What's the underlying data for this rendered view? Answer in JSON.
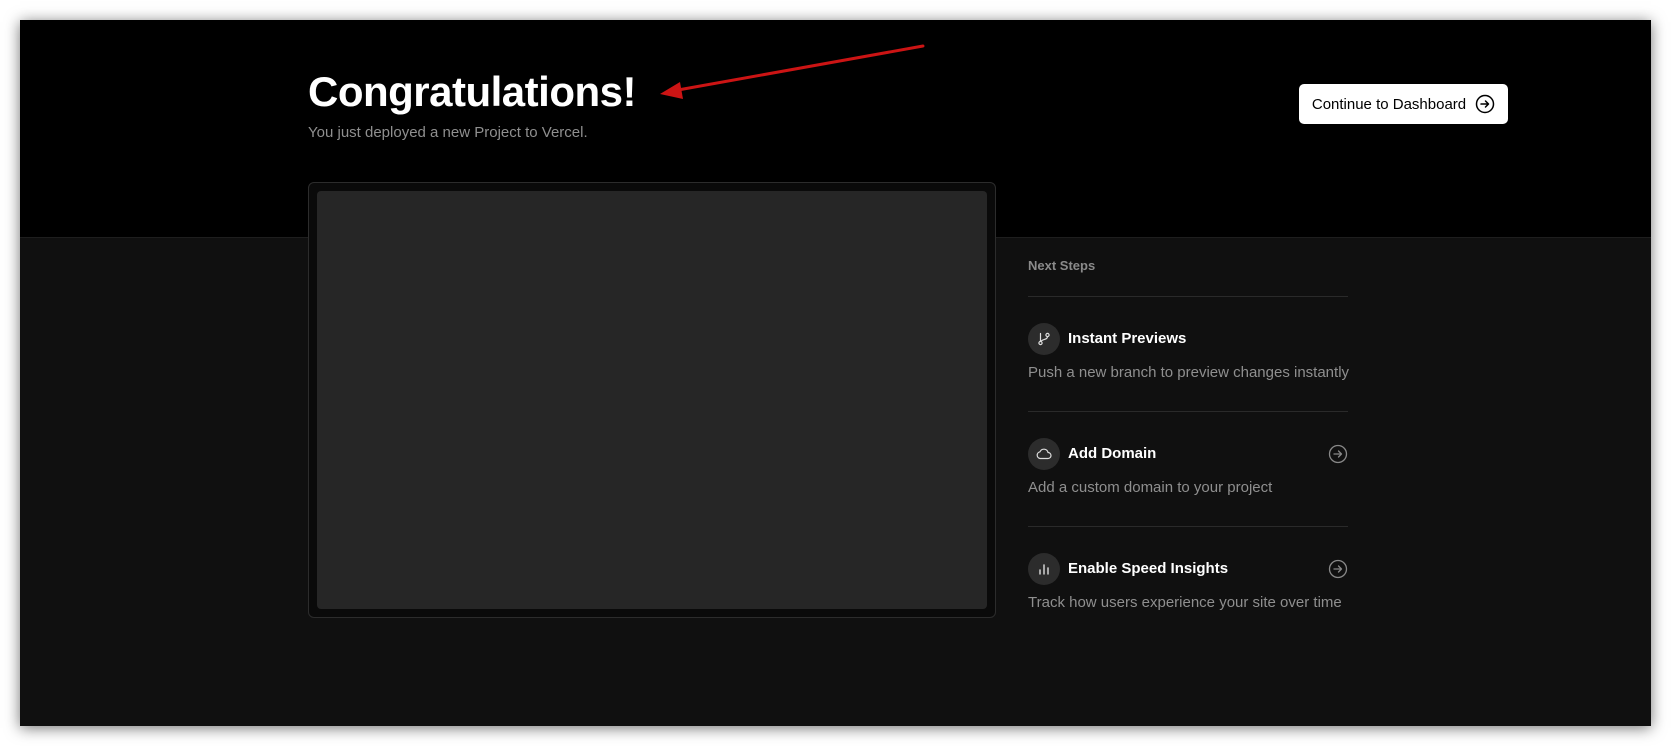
{
  "colors": {
    "hero_background": "#000000",
    "page_background": "#101010",
    "preview_placeholder": "#262626",
    "annotation_arrow": "#cc1414",
    "muted_text": "#8f8f8f"
  },
  "header": {
    "title": "Congratulations!",
    "subtitle": "You just deployed a new Project to Vercel.",
    "cta_label": "Continue to Dashboard",
    "cta_icon": "arrow-right-circle-icon"
  },
  "next_steps": {
    "header": "Next Steps",
    "items": [
      {
        "title": "Instant Previews",
        "description": "Push a new branch to preview changes instantly",
        "icon": "git-branch-icon",
        "has_arrow": false
      },
      {
        "title": "Add Domain",
        "description": "Add a custom domain to your project",
        "icon": "cloud-icon",
        "has_arrow": true
      },
      {
        "title": "Enable Speed Insights",
        "description": "Track how users experience your site over time",
        "icon": "bar-chart-icon",
        "has_arrow": true
      }
    ]
  }
}
